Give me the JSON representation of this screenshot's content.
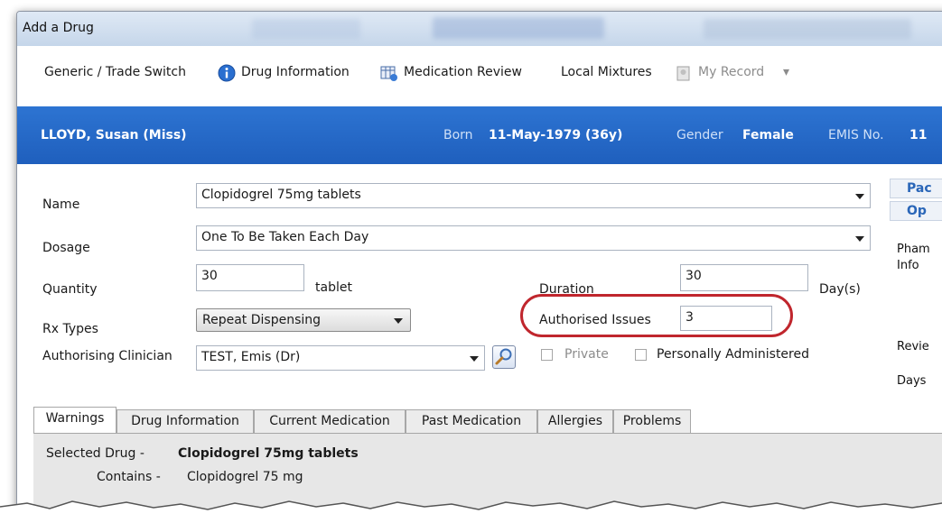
{
  "window": {
    "title": "Add a Drug"
  },
  "toolbar": {
    "generic_trade": "Generic / Trade Switch",
    "drug_information": "Drug Information",
    "medication_review": "Medication Review",
    "local_mixtures": "Local Mixtures",
    "my_record": "My Record",
    "my_record_arrow": "▾"
  },
  "patient": {
    "name": "LLOYD, Susan (Miss)",
    "born_label": "Born",
    "born_value": "11-May-1979 (36y)",
    "gender_label": "Gender",
    "gender_value": "Female",
    "emis_label": "EMIS No.",
    "emis_value": "11"
  },
  "form": {
    "name_label": "Name",
    "name_value": "Clopidogrel 75mg tablets",
    "dosage_label": "Dosage",
    "dosage_value": "One To Be Taken Each Day",
    "quantity_label": "Quantity",
    "quantity_value": "30",
    "quantity_unit": "tablet",
    "duration_label": "Duration",
    "duration_value": "30",
    "duration_unit": "Day(s)",
    "rx_label": "Rx Types",
    "rx_value": "Repeat Dispensing",
    "authorised_label": "Authorised Issues",
    "authorised_value": "3",
    "clinician_label": "Authorising Clinician",
    "clinician_value": "TEST, Emis (Dr)",
    "private_label": "Private",
    "personally_label": "Personally Administered"
  },
  "side_panel": {
    "header1": "Pac",
    "header2": "Op",
    "pharm_line1": "Pham",
    "pharm_line2": "Info",
    "review": "Revie",
    "days": "Days"
  },
  "tabs": [
    "Warnings",
    "Drug Information",
    "Current Medication",
    "Past Medication",
    "Allergies",
    "Problems"
  ],
  "warnings": {
    "selected_label": "Selected Drug -",
    "selected_value": "Clopidogrel 75mg tablets",
    "contains_label": "Contains -",
    "contains_value": "Clopidogrel 75 mg"
  },
  "colors": {
    "accent": "#2468c8",
    "highlight": "#c0262d"
  }
}
